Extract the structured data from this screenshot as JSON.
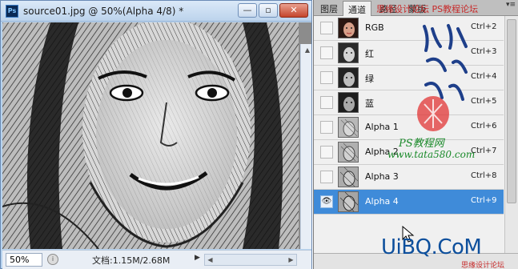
{
  "document": {
    "app_icon_label": "Ps",
    "title": "source01.jpg @ 50%(Alpha 4/8) *",
    "zoom": "50%",
    "info": "文档:1.15M/2.68M"
  },
  "window_buttons": {
    "minimize": "—",
    "maximize": "▫",
    "close": "✕"
  },
  "panel": {
    "tabs": [
      "图层",
      "通道",
      "路径",
      "蒙版"
    ],
    "active_tab": "通道",
    "channels": [
      {
        "name": "RGB",
        "shortcut": "Ctrl+2",
        "visible": false,
        "selected": false,
        "thumb": "color"
      },
      {
        "name": "红",
        "shortcut": "Ctrl+3",
        "visible": false,
        "selected": false,
        "thumb": "gray"
      },
      {
        "name": "绿",
        "shortcut": "Ctrl+4",
        "visible": false,
        "selected": false,
        "thumb": "gray"
      },
      {
        "name": "蓝",
        "shortcut": "Ctrl+5",
        "visible": false,
        "selected": false,
        "thumb": "gray"
      },
      {
        "name": "Alpha 1",
        "shortcut": "Ctrl+6",
        "visible": false,
        "selected": false,
        "thumb": "sketch"
      },
      {
        "name": "Alpha 2",
        "shortcut": "Ctrl+7",
        "visible": false,
        "selected": false,
        "thumb": "sketch"
      },
      {
        "name": "Alpha 3",
        "shortcut": "Ctrl+8",
        "visible": false,
        "selected": false,
        "thumb": "sketch"
      },
      {
        "name": "Alpha 4",
        "shortcut": "Ctrl+9",
        "visible": true,
        "selected": true,
        "thumb": "sketch"
      }
    ]
  },
  "watermarks": {
    "top": "思缘设计论坛 PS教程论坛",
    "calligraphy": "他她我帮你",
    "seal": "红",
    "site": "PS教程网",
    "url": "www.tata580.com",
    "brand": "UiBQ.CoM",
    "brand_small": "思缘设计论坛"
  },
  "colors": {
    "selection": "#3f8bd9",
    "titlebar": "#bcd3ec",
    "watermark_green": "#1a8a2a",
    "watermark_blue": "#0d4f9c"
  }
}
